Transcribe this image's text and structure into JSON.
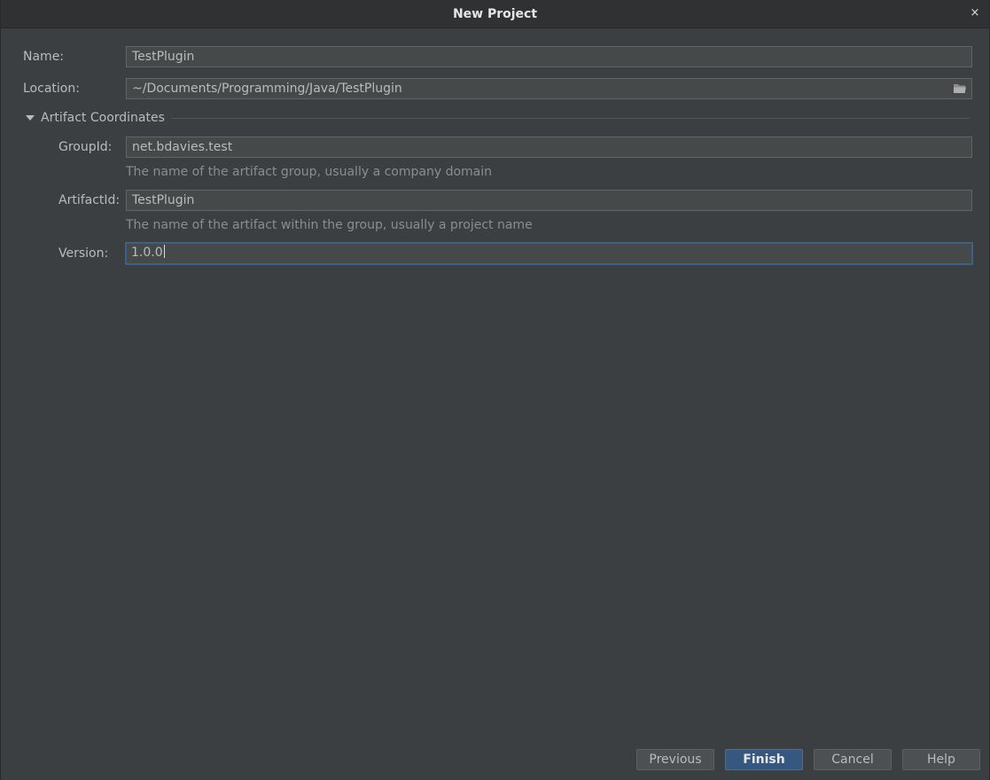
{
  "window": {
    "title": "New Project",
    "close_glyph": "×"
  },
  "form": {
    "name_label": "Name:",
    "name_value": "TestPlugin",
    "location_label": "Location:",
    "location_value": "~/Documents/Programming/Java/TestPlugin",
    "location_icon": "folder-icon"
  },
  "artifact": {
    "section_label": "Artifact Coordinates",
    "expanded": true,
    "group_label": "GroupId:",
    "group_value": "net.bdavies.test",
    "group_hint": "The name of the artifact group, usually a company domain",
    "artifact_label": "ArtifactId:",
    "artifact_value": "TestPlugin",
    "artifact_hint": "The name of the artifact within the group, usually a project name",
    "version_label": "Version:",
    "version_value": "1.0.0"
  },
  "buttons": {
    "previous": "Previous",
    "finish": "Finish",
    "cancel": "Cancel",
    "help": "Help"
  },
  "colors": {
    "background": "#3c3f41",
    "primary_button": "#365880",
    "focus_border": "#3d6185"
  }
}
